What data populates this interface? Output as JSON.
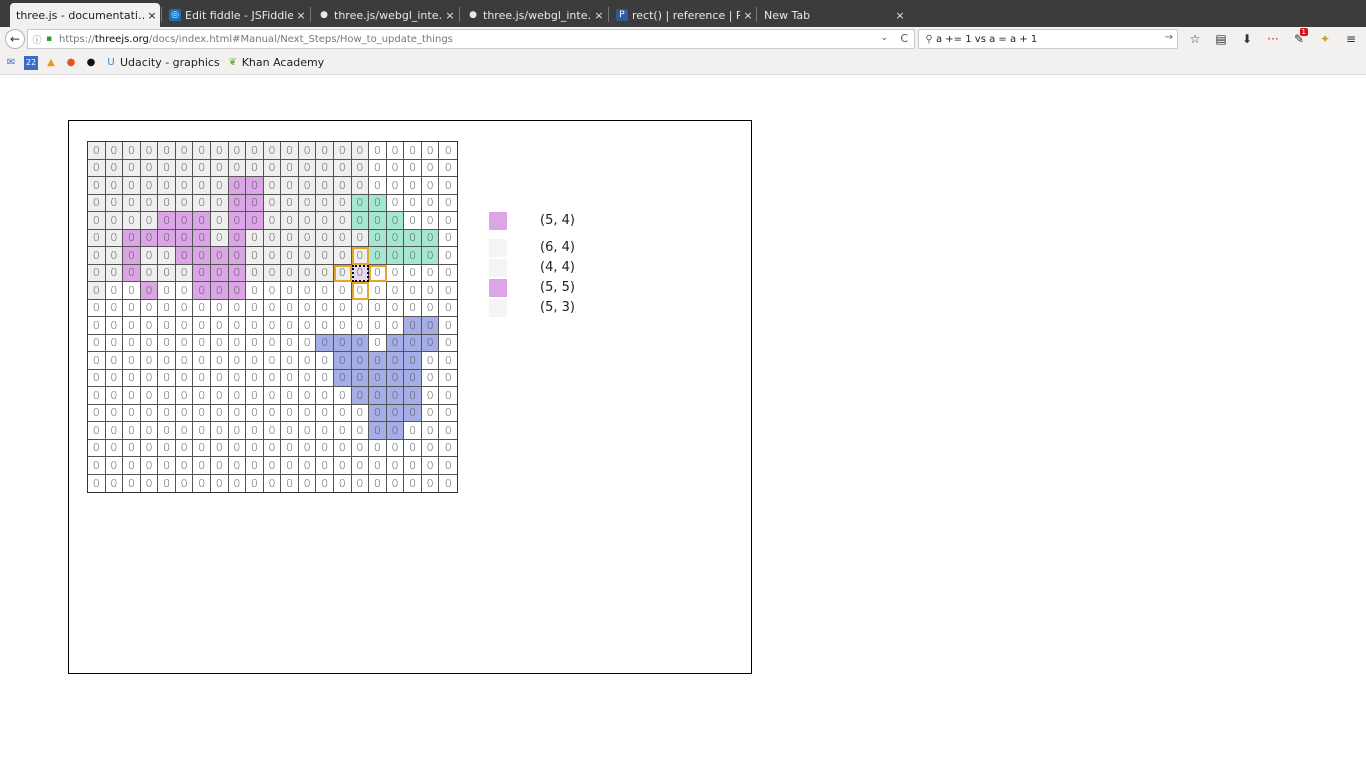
{
  "tabs": [
    {
      "title": "three.js - documentati…",
      "icon": "",
      "active": true
    },
    {
      "title": "Edit fiddle - JSFiddle",
      "icon": "jsfiddle-icon",
      "active": false
    },
    {
      "title": "three.js/webgl_inte…",
      "icon": "github-icon",
      "active": false
    },
    {
      "title": "three.js/webgl_inte…",
      "icon": "github-icon",
      "active": false
    },
    {
      "title": "rect() | reference | P…",
      "icon": "processing-icon",
      "active": false
    },
    {
      "title": "New Tab",
      "icon": "",
      "active": false
    }
  ],
  "tab_close_glyph": "×",
  "nav": {
    "back_glyph": "←",
    "url_prefix": "https://",
    "url_host": "threejs.org",
    "url_path": "/docs/index.html#Manual/Next_Steps/How_to_update_things",
    "dropdown_glyph": "⌄",
    "reload_glyph": "C",
    "search_text": "a += 1 vs a = a + 1",
    "search_go_glyph": "→",
    "icons": [
      {
        "name": "bookmark-star-icon",
        "glyph": "☆"
      },
      {
        "name": "clipboard-icon",
        "glyph": "▤"
      },
      {
        "name": "download-icon",
        "glyph": "⬇"
      },
      {
        "name": "lastpass-icon",
        "glyph": "···"
      },
      {
        "name": "extension-badge-icon",
        "glyph": "✎",
        "badge": "1"
      },
      {
        "name": "extension-icon",
        "glyph": "✦"
      },
      {
        "name": "menu-icon",
        "glyph": "≡"
      }
    ]
  },
  "bookmarks": [
    {
      "icon": "mail-icon",
      "glyph": "✉",
      "label": "",
      "color": "#3a6ec4"
    },
    {
      "icon": "calendar-icon",
      "glyph": "22",
      "label": "",
      "color": "#3a6ec4"
    },
    {
      "icon": "drive-icon",
      "glyph": "▲",
      "label": "",
      "color": "#e89a1c"
    },
    {
      "icon": "orange-circle-icon",
      "glyph": "●",
      "label": "",
      "color": "#e8541c"
    },
    {
      "icon": "github-icon",
      "glyph": "●",
      "label": "",
      "color": "#111111"
    },
    {
      "icon": "udacity-icon",
      "glyph": "U",
      "label": "Udacity - graphics",
      "color": "#1c8de8"
    },
    {
      "icon": "khan-leaf-icon",
      "glyph": "❦",
      "label": "Khan Academy",
      "color": "#6bb33a"
    }
  ],
  "grid": {
    "cols": 21,
    "rows": 20,
    "cell_value": "0",
    "colors": {
      "grey": "#efefef",
      "pink": "#dba5e6",
      "green": "#a6e8cf",
      "blue": "#a6aee8",
      "orange": "#e3a62a"
    },
    "grey_region": [
      [
        0,
        0,
        15
      ],
      [
        1,
        0,
        15
      ],
      [
        2,
        0,
        15
      ],
      [
        3,
        0,
        15
      ],
      [
        4,
        0,
        15
      ],
      [
        5,
        0,
        15
      ],
      [
        6,
        0,
        15
      ],
      [
        7,
        0,
        14
      ],
      [
        8,
        0,
        0
      ]
    ],
    "pink_cells": [
      [
        2,
        8
      ],
      [
        2,
        9
      ],
      [
        3,
        8
      ],
      [
        3,
        9
      ],
      [
        4,
        4
      ],
      [
        4,
        5
      ],
      [
        4,
        6
      ],
      [
        4,
        8
      ],
      [
        4,
        9
      ],
      [
        5,
        2
      ],
      [
        5,
        3
      ],
      [
        5,
        4
      ],
      [
        5,
        5
      ],
      [
        5,
        6
      ],
      [
        5,
        8
      ],
      [
        6,
        2
      ],
      [
        6,
        5
      ],
      [
        6,
        6
      ],
      [
        6,
        7
      ],
      [
        6,
        8
      ],
      [
        7,
        2
      ],
      [
        7,
        6
      ],
      [
        7,
        7
      ],
      [
        7,
        8
      ],
      [
        8,
        3
      ],
      [
        8,
        6
      ],
      [
        8,
        7
      ],
      [
        8,
        8
      ]
    ],
    "green_cells": [
      [
        3,
        15
      ],
      [
        3,
        16
      ],
      [
        4,
        15
      ],
      [
        4,
        16
      ],
      [
        4,
        17
      ],
      [
        5,
        16
      ],
      [
        5,
        17
      ],
      [
        5,
        18
      ],
      [
        5,
        19
      ],
      [
        6,
        16
      ],
      [
        6,
        17
      ],
      [
        6,
        18
      ],
      [
        6,
        19
      ]
    ],
    "blue_cells": [
      [
        10,
        18
      ],
      [
        10,
        19
      ],
      [
        11,
        13
      ],
      [
        11,
        14
      ],
      [
        11,
        15
      ],
      [
        11,
        17
      ],
      [
        11,
        18
      ],
      [
        11,
        19
      ],
      [
        12,
        14
      ],
      [
        12,
        15
      ],
      [
        12,
        16
      ],
      [
        12,
        17
      ],
      [
        12,
        18
      ],
      [
        13,
        14
      ],
      [
        13,
        15
      ],
      [
        13,
        16
      ],
      [
        13,
        17
      ],
      [
        13,
        18
      ],
      [
        14,
        15
      ],
      [
        14,
        16
      ],
      [
        14,
        17
      ],
      [
        14,
        18
      ],
      [
        15,
        16
      ],
      [
        15,
        17
      ],
      [
        15,
        18
      ],
      [
        16,
        16
      ],
      [
        16,
        17
      ]
    ],
    "orange_cells": [
      [
        6,
        15
      ],
      [
        7,
        14
      ],
      [
        7,
        16
      ],
      [
        8,
        15
      ]
    ],
    "current_cell": [
      7,
      15
    ]
  },
  "legend": [
    {
      "label": "(5, 4)",
      "color": "#dba5e6"
    },
    {
      "label": "(6, 4)",
      "color": "#f4f4f4"
    },
    {
      "label": "(4, 4)",
      "color": "#f4f4f4"
    },
    {
      "label": "(5, 5)",
      "color": "#dba5e6"
    },
    {
      "label": "(5, 3)",
      "color": "#f4f4f4"
    }
  ]
}
